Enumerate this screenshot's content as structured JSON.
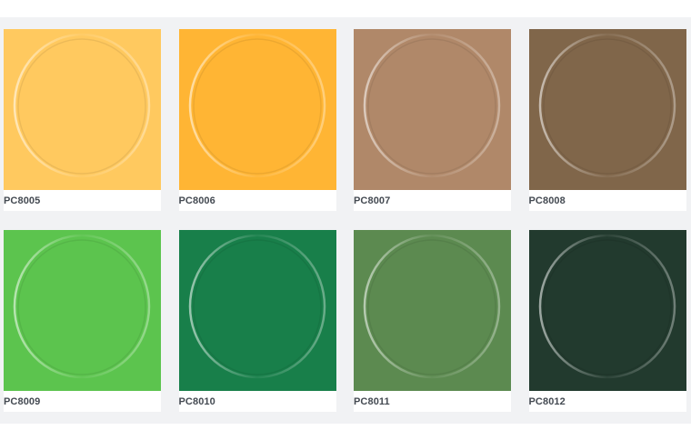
{
  "swatches": [
    {
      "code": "PC8005",
      "color": "#ffc95f"
    },
    {
      "code": "PC8006",
      "color": "#ffb534"
    },
    {
      "code": "PC8007",
      "color": "#b08869"
    },
    {
      "code": "PC8008",
      "color": "#80664a"
    },
    {
      "code": "PC8009",
      "color": "#5cc44e"
    },
    {
      "code": "PC8010",
      "color": "#187f4a"
    },
    {
      "code": "PC8011",
      "color": "#5c8a50"
    },
    {
      "code": "PC8012",
      "color": "#223a2e"
    }
  ]
}
